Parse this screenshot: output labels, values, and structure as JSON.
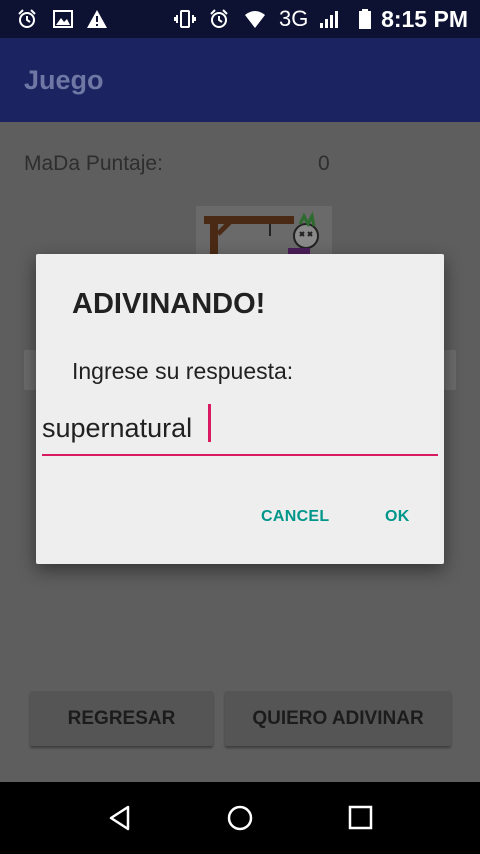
{
  "status_bar": {
    "left_icons": [
      "alarm-icon",
      "image-icon",
      "warning-icon"
    ],
    "right_icons": [
      "vibrate-icon",
      "alarm-icon",
      "wifi-icon",
      "signal-icon",
      "battery-icon"
    ],
    "network": "3G",
    "time": "8:15 PM"
  },
  "app_bar": {
    "title": "Juego"
  },
  "main": {
    "score_label": "MaDa Puntaje:",
    "score_value": "0",
    "back_button": "REGRESAR",
    "guess_button": "QUIERO ADIVINAR"
  },
  "dialog": {
    "title": "ADIVINANDO!",
    "message": "Ingrese su respuesta:",
    "input_value": "supernatural",
    "cancel_label": "CANCEL",
    "ok_label": "OK",
    "accent_color": "#d81b60",
    "button_color": "#00968a"
  },
  "nav_bar": {
    "buttons": [
      "back-icon",
      "home-icon",
      "recents-icon"
    ]
  }
}
